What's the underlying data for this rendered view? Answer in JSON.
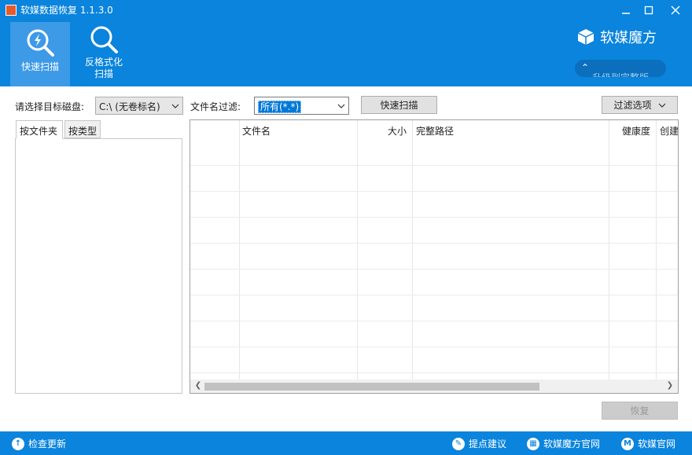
{
  "window": {
    "title": "软媒数据恢复 1.1.3.0"
  },
  "toolbar": {
    "quick_scan": "快速扫描",
    "format_scan_line1": "反格式化",
    "format_scan_line2": "扫描"
  },
  "brand": {
    "name": "软媒魔方",
    "upgrade": "升级到完整版"
  },
  "controls": {
    "disk_label": "请选择目标磁盘:",
    "disk_value": "C:\\  (无卷标名)",
    "filter_label": "文件名过滤:",
    "filter_value": "所有(*.*)",
    "scan_button": "快速扫描",
    "filter_options_button": "过滤选项"
  },
  "tabs": [
    "按文件夹",
    "按类型"
  ],
  "columns": [
    "文件名",
    "大小",
    "完整路径",
    "健康度",
    "创建"
  ],
  "recover_button": "恢复",
  "statusbar": {
    "check_update": "检查更新",
    "feedback": "提点建议",
    "mofang_site": "软媒魔方官网",
    "ruanmei_site": "软媒官网"
  },
  "colors": {
    "accent": "#0a84dc",
    "active_tab": "#3d9ae6"
  }
}
